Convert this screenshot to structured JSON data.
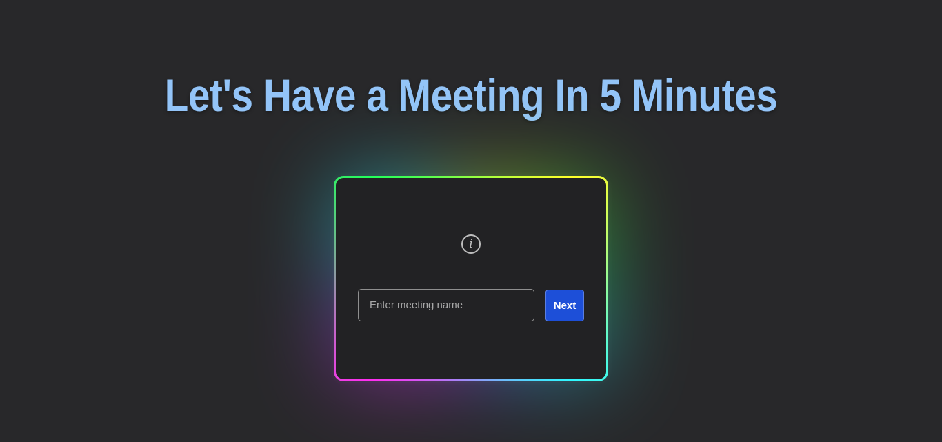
{
  "header": {
    "title": "Let's Have a Meeting In 5 Minutes"
  },
  "card": {
    "info_icon": "info-icon",
    "input": {
      "placeholder": "Enter meeting name",
      "value": ""
    },
    "next_label": "Next"
  },
  "colors": {
    "background": "#28282a",
    "title": "#93c4f8",
    "card_background": "#222224",
    "button": "#1d4fd8",
    "border_gradient": [
      "#22ff5a",
      "#ffff2a",
      "#2ef8ff",
      "#ff2df0"
    ]
  }
}
